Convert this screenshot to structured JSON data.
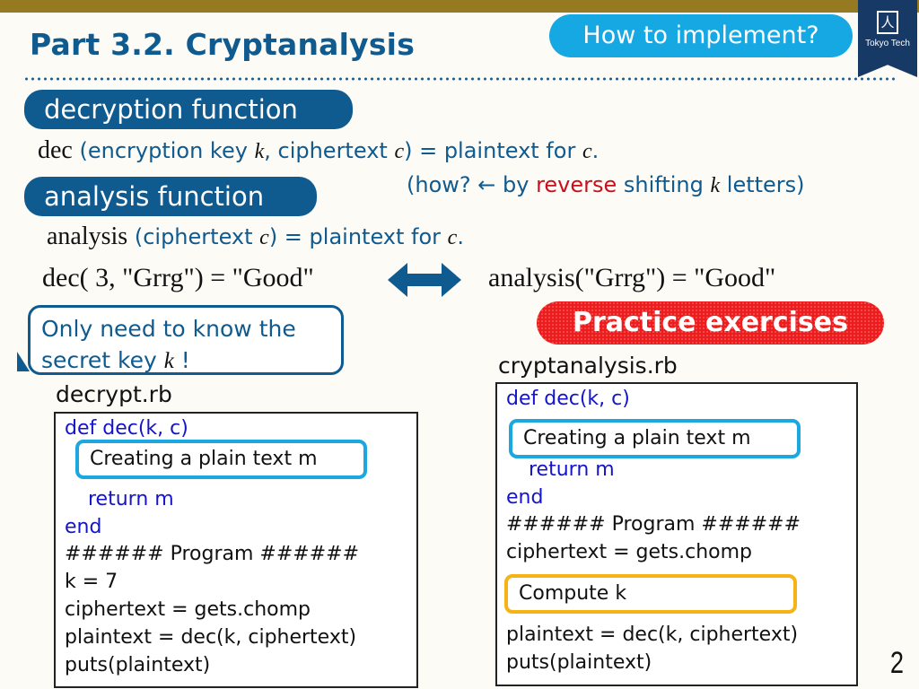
{
  "header": {
    "title": "Part 3.2.  Cryptanalysis",
    "how_button": "How to implement?",
    "logo_text": "Tokyo Tech",
    "logo_emblem": "人"
  },
  "decryption": {
    "pill": "decryption function",
    "fn": "dec",
    "open": " (encryption key ",
    "k": "k",
    "mid": ", ciphertext ",
    "c": "c",
    "rest": ") = plaintext for ",
    "c2": "c",
    "end": ".",
    "how_pre": "(how? ← by ",
    "how_red": "reverse",
    "how_mid": " shifting ",
    "how_k": "k",
    "how_end": " letters)"
  },
  "analysis": {
    "pill": "analysis function",
    "fn": "analysis",
    "open": " (ciphertext ",
    "c": "c",
    "rest": ") = plaintext for ",
    "c2": "c",
    "end": "."
  },
  "examples": {
    "left": "dec( 3, \"Grrg\") = \"Good\"",
    "right": "analysis(\"Grrg\") = \"Good\""
  },
  "callout": {
    "line1": "Only need to know the",
    "line2_pre": "secret key ",
    "line2_k": "k",
    "line2_end": " !"
  },
  "practice_label": "Practice exercises",
  "left_file": {
    "name": "decrypt.rb",
    "def": "def dec(k, c)",
    "box": "Creating a plain text m",
    "ret": "return m",
    "end": "end",
    "lines": [
      "###### Program ######",
      "k = 7",
      "ciphertext = gets.chomp",
      "plaintext = dec(k, ciphertext)",
      "puts(plaintext)"
    ]
  },
  "right_file": {
    "name": "cryptanalysis.rb",
    "def": "def dec(k, c)",
    "box": "Creating a plain text m",
    "ret": "return m",
    "end": "end",
    "program": "###### Program ######",
    "cipher": "ciphertext = gets.chomp",
    "compute_box": "Compute k",
    "plain": "plaintext = dec(k, ciphertext)",
    "puts": "puts(plaintext)"
  },
  "page_number": "2"
}
